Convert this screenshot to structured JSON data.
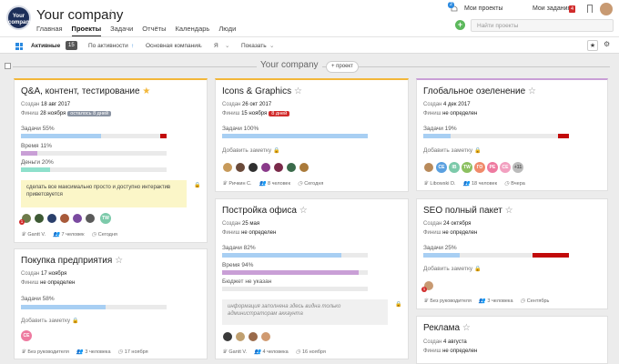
{
  "header": {
    "logo_text": "Your\ncompany",
    "company": "Your company",
    "nav": [
      "Главная",
      "Проекты",
      "Задачи",
      "Отчёты",
      "Календарь",
      "Люди"
    ],
    "active_nav": "Проекты",
    "notif_count": "2",
    "my_projects": "Мои проекты",
    "my_tasks": "Мои задания",
    "my_tasks_count": "4",
    "search_placeholder": "Найти проекты",
    "add_label": "+"
  },
  "filter": {
    "active": "Активные",
    "active_count": "15",
    "sort": "По активности",
    "sort_arrow": "↑",
    "company": "Основная компания",
    "me": "Я",
    "show": "Показать",
    "star": "★",
    "gear": "⚙"
  },
  "group": {
    "title": "Your company",
    "add": "+ проект"
  },
  "cards": {
    "c1": {
      "title": "Q&A, контент, тестирование",
      "created_l": "Создан",
      "created": "18 авг 2017",
      "finish_l": "Финиш",
      "finish": "28 ноября",
      "tag": "осталось 8 дней",
      "m1_label": "Задачи 55%",
      "m1_value": 55,
      "m2_label": "Время 11%",
      "m2_value": 11,
      "m3_label": "Деньги 20%",
      "m3_value": 20,
      "note": "сделать все максимально просто и доступно интерактив приветсвуется",
      "avatar_badge": "1",
      "avatar_initials": "TW",
      "f_lead": "Gantt V.",
      "f_people": "7 человек",
      "f_date": "Сегодня"
    },
    "c2": {
      "title": "Покупка предприятия",
      "created_l": "Создан",
      "created": "17 ноября",
      "finish_l": "Финиш",
      "finish": "не определен",
      "m1_label": "Задачи 58%",
      "m1_value": 58,
      "addnote": "Добавить заметку",
      "avatar_initials": "CE",
      "f_lead": "Без руководителя",
      "f_people": "3 человека",
      "f_date": "17 ноября"
    },
    "c3": {
      "title": "Icons & Graphics",
      "created_l": "Создан",
      "created": "26 окт 2017",
      "finish_l": "Финиш",
      "finish": "15 ноября",
      "tag": "8 дней",
      "m1_label": "Задачи 100%",
      "m1_value": 100,
      "addnote": "Добавить заметку",
      "f_lead": "Ричкин С.",
      "f_people": "8 человек",
      "f_date": "Сегодня"
    },
    "c4": {
      "title": "Постройка офиса",
      "created_l": "Создан",
      "created": "25 мая",
      "finish_l": "Финиш",
      "finish": "не определен",
      "m1_label": "Задачи 82%",
      "m1_value": 82,
      "m2_label": "Время 94%",
      "m2_value": 94,
      "m3_label": "Бюджет не указан",
      "note": "информация заполнена здесь видна только администраторам аккаунта",
      "f_lead": "Gantt V.",
      "f_people": "4 человека",
      "f_date": "16 ноября"
    },
    "c5": {
      "title": "Глобальное озеленение",
      "created_l": "Создан",
      "created": "4 дек 2017",
      "finish_l": "Финиш",
      "finish": "не определен",
      "m1_label": "Задачи 19%",
      "m1_value": 19,
      "addnote": "Добавить заметку",
      "av_ini": [
        "CE",
        "IB",
        "TW",
        "ГО",
        "PE",
        "CE"
      ],
      "more": "+11",
      "f_lead": "Libowski D.",
      "f_people": "18 человек",
      "f_date": "Вчера"
    },
    "c6": {
      "title": "SEO полный пакет",
      "created_l": "Создан",
      "created": "24 октября",
      "finish_l": "Финиш",
      "finish": "не определен",
      "m1_label": "Задачи 25%",
      "m1_value": 25,
      "addnote": "Добавить заметку",
      "avatar_badge": "1",
      "f_lead": "Без руководителя",
      "f_people": "3 человека",
      "f_date": "Сентябрь"
    },
    "c7": {
      "title": "Реклама",
      "created_l": "Создан",
      "created": "4 августа",
      "finish_l": "Финиш",
      "finish": "не определен"
    }
  },
  "colors": {
    "tasks": "#a8cff3",
    "time": "#c99fd6",
    "money": "#8fe0cc",
    "overdue": "#c20a0a",
    "accent": "#2b8ae0"
  }
}
